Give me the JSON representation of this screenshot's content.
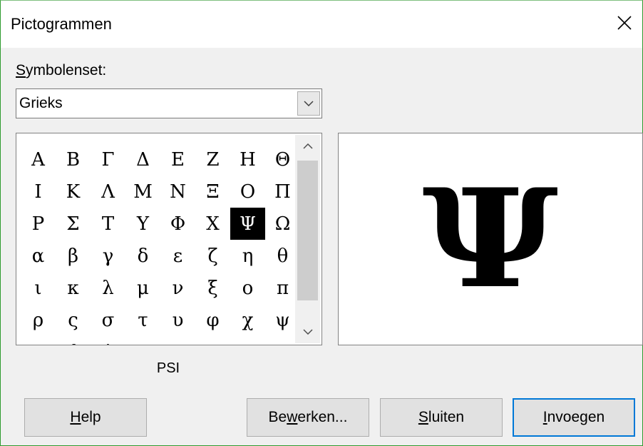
{
  "window": {
    "title": "Pictogrammen",
    "close_icon": "close-icon"
  },
  "symbolset": {
    "label_prefix": "",
    "label_mnemonic": "S",
    "label_rest": "ymbolenset:",
    "value": "Grieks"
  },
  "grid": {
    "rows": [
      [
        "Α",
        "Β",
        "Γ",
        "Δ",
        "Ε",
        "Ζ",
        "Η",
        "Θ"
      ],
      [
        "Ι",
        "Κ",
        "Λ",
        "Μ",
        "Ν",
        "Ξ",
        "Ο",
        "Π"
      ],
      [
        "Ρ",
        "Σ",
        "Τ",
        "Υ",
        "Φ",
        "Χ",
        "Ψ",
        "Ω"
      ],
      [
        "α",
        "β",
        "γ",
        "δ",
        "ε",
        "ζ",
        "η",
        "θ"
      ],
      [
        "ι",
        "κ",
        "λ",
        "μ",
        "ν",
        "ξ",
        "ο",
        "π"
      ],
      [
        "ρ",
        "ς",
        "σ",
        "τ",
        "υ",
        "φ",
        "χ",
        "ψ"
      ],
      [
        "ω",
        "ϑ",
        "ϕ",
        "",
        "",
        "",
        "",
        ""
      ]
    ],
    "selected": {
      "row": 2,
      "col": 6
    }
  },
  "preview": {
    "glyph": "Ψ"
  },
  "symbol_name": "PSI",
  "buttons": {
    "help": {
      "mnemonic": "H",
      "rest": "elp"
    },
    "edit": {
      "before": "Be",
      "mnemonic": "w",
      "rest": "erken..."
    },
    "close": {
      "mnemonic": "S",
      "rest": "luiten"
    },
    "insert": {
      "mnemonic": "I",
      "rest": "nvoegen"
    }
  }
}
